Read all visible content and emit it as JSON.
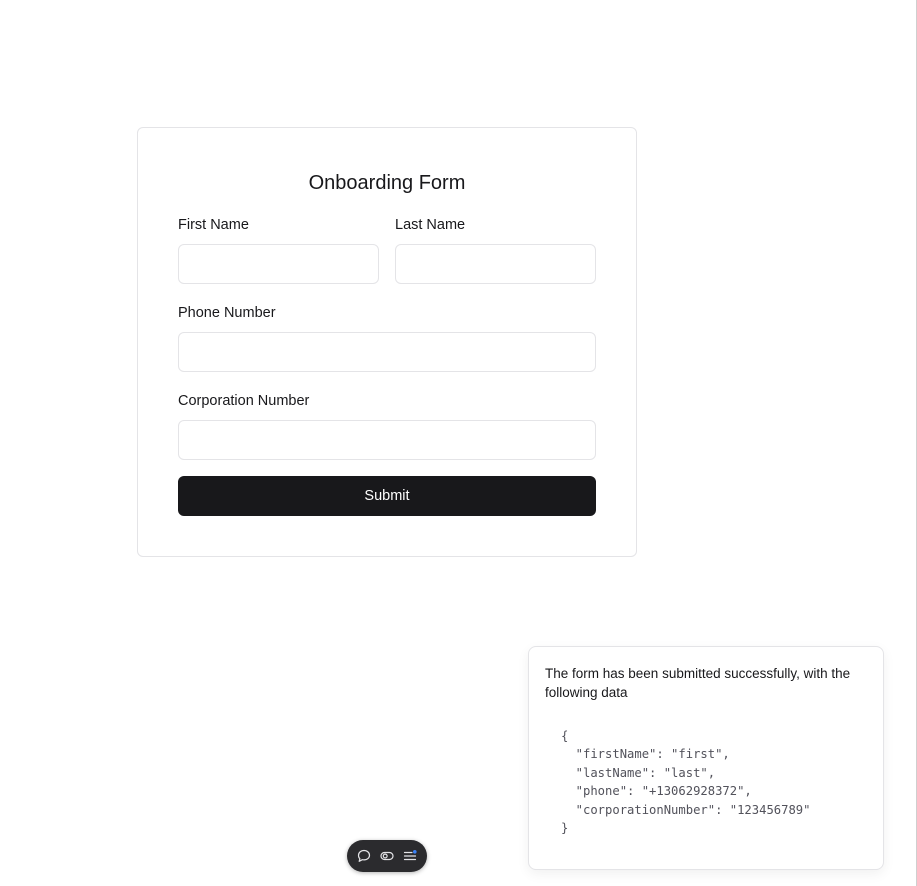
{
  "form": {
    "title": "Onboarding Form",
    "first_name": {
      "label": "First Name",
      "value": "",
      "placeholder": ""
    },
    "last_name": {
      "label": "Last Name",
      "value": "",
      "placeholder": ""
    },
    "phone": {
      "label": "Phone Number",
      "value": "",
      "placeholder": ""
    },
    "corporation": {
      "label": "Corporation Number",
      "value": "",
      "placeholder": ""
    },
    "submit_label": "Submit"
  },
  "toast": {
    "message": "The form has been submitted successfully, with the following data",
    "json_text": "{\n  \"firstName\": \"first\",\n  \"lastName\": \"last\",\n  \"phone\": \"+13062928372\",\n  \"corporationNumber\": \"123456789\"\n}"
  },
  "toolbar": {
    "icons": [
      "comment-icon",
      "toggle-icon",
      "menu-icon"
    ]
  },
  "colors": {
    "button_bg": "#18181b",
    "border": "#e4e4e7",
    "toolbar_bg": "#2b2b2e",
    "badge_blue": "#3b82f6"
  }
}
